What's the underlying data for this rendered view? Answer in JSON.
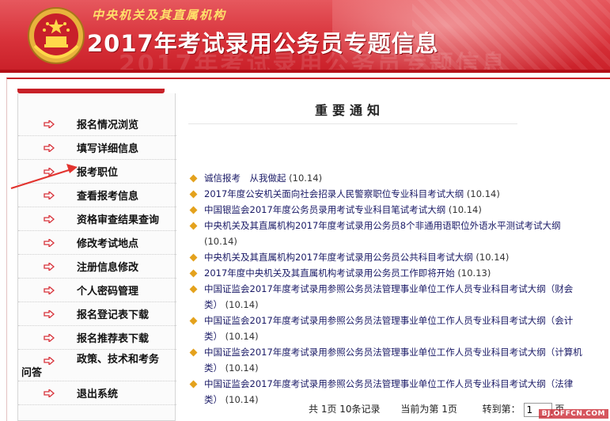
{
  "header": {
    "subtitle": "中央机关及其直属机构",
    "title": "2017年考试录用公务员专题信息"
  },
  "sidebar": {
    "items": [
      {
        "label": "报名情况浏览"
      },
      {
        "label": "填写详细信息"
      },
      {
        "label": "报考职位"
      },
      {
        "label": "查看报考信息"
      },
      {
        "label": "资格审查结果查询"
      },
      {
        "label": "修改考试地点"
      },
      {
        "label": "注册信息修改"
      },
      {
        "label": "个人密码管理"
      },
      {
        "label": "报名登记表下载"
      },
      {
        "label": "报名推荐表下载"
      },
      {
        "label": "政策、技术和考务",
        "label_wrap": "问答"
      },
      {
        "label": "退出系统"
      }
    ]
  },
  "main": {
    "notice_title": "重要通知",
    "news": [
      {
        "text": "诚信报考　从我做起",
        "date": "(10.14)"
      },
      {
        "text": "2017年度公安机关面向社会招录人民警察职位专业科目考试大纲",
        "date": "(10.14)"
      },
      {
        "text": "中国银监会2017年度公务员录用考试专业科目笔试考试大纲",
        "date": "(10.14)"
      },
      {
        "text": "中央机关及其直属机构2017年度考试录用公务员8个非通用语职位外语水平测试考试大纲",
        "date": "(10.14)"
      },
      {
        "text": "中央机关及其直属机构2017年度考试录用公务员公共科目考试大纲",
        "date": "(10.14)"
      },
      {
        "text": "2017年度中央机关及其直属机构考试录用公务员工作即将开始",
        "date": "(10.13)"
      },
      {
        "text": "中国证监会2017年度考试录用参照公务员法管理事业单位工作人员专业科目考试大纲（财会类）",
        "date": "(10.14)"
      },
      {
        "text": "中国证监会2017年度考试录用参照公务员法管理事业单位工作人员专业科目考试大纲（会计类）",
        "date": "(10.14)"
      },
      {
        "text": "中国证监会2017年度考试录用参照公务员法管理事业单位工作人员专业科目考试大纲（计算机类）",
        "date": "(10.14)"
      },
      {
        "text": "中国证监会2017年度考试录用参照公务员法管理事业单位工作人员专业科目考试大纲（法律类）",
        "date": "(10.14)"
      }
    ],
    "pager": {
      "total": "共 1页 10条记录",
      "current": "当前为第 1页",
      "jump_label": "转到第：",
      "page_value": "1",
      "page_suffix": "页"
    }
  },
  "watermark": "BJ.OFFCN.COM",
  "colors": {
    "banner_red": "#d8323a",
    "accent_red": "#c82128",
    "link_navy": "#1a1a66",
    "bullet_gold": "#e4a21d",
    "subtitle_gold": "#ffe16a"
  },
  "icons": {
    "emblem": "national-emblem-icon",
    "menu_arrow": "arrow-right-icon",
    "bullet": "diamond-bullet-icon"
  }
}
